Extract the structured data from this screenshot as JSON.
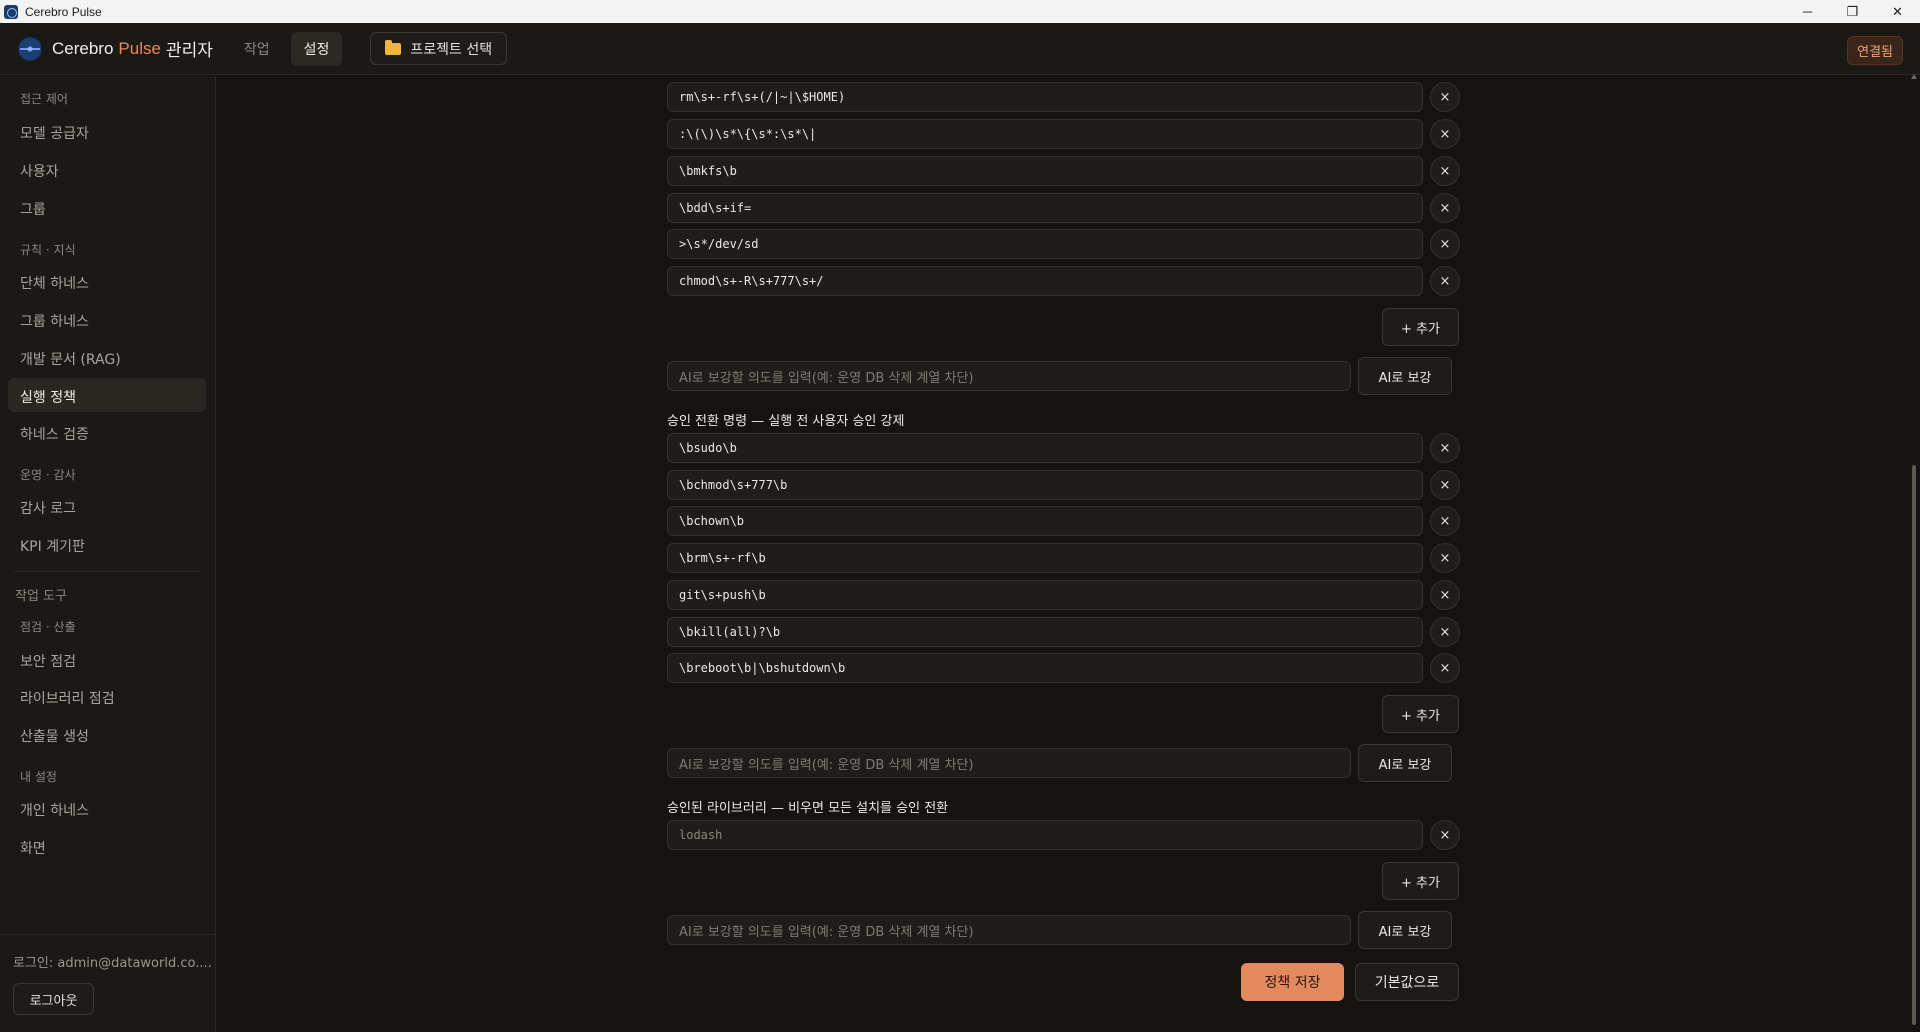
{
  "window": {
    "title": "Cerebro Pulse",
    "minimize": "─",
    "maximize": "❐",
    "close": "✕"
  },
  "header": {
    "brand_name": "Cerebro",
    "brand_pulse": "Pulse",
    "brand_suffix": "관리자",
    "tabs": [
      {
        "label": "작업"
      },
      {
        "label": "설정"
      }
    ],
    "project_button": "프로젝트 선택",
    "connection_status": "연결됨"
  },
  "sidebar": {
    "sections": [
      {
        "title": "접근 제어",
        "items": [
          "모델 공급자",
          "사용자",
          "그룹"
        ]
      },
      {
        "title": "규칙 · 지식",
        "items": [
          "단체 하네스",
          "그룹 하네스",
          "개발 문서 (RAG)",
          "실행 정책",
          "하네스 검증"
        ]
      },
      {
        "title": "운영 · 감사",
        "items": [
          "감사 로그",
          "KPI 계기판"
        ]
      },
      {
        "title": "작업 도구",
        "items": []
      },
      {
        "title": "점검 · 산출",
        "items": [
          "보안 점검",
          "라이브러리 점검",
          "산출물 생성"
        ]
      },
      {
        "title": "내 설정",
        "items": [
          "개인 하네스",
          "화면"
        ]
      }
    ],
    "active_item": "실행 정책",
    "login_text": "로그인: admin@dataworld.co....",
    "logout": "로그아웃"
  },
  "main": {
    "blocked_rules": [
      "rm\\s+-rf\\s+(/|~|\\$HOME)",
      ":\\(\\)\\s*\\{\\s*:\\s*\\|",
      "\\bmkfs\\b",
      "\\bdd\\s+if=",
      ">\\s*/dev/sd",
      "chmod\\s+-R\\s+777\\s+/"
    ],
    "add_label": "+ 추가",
    "ai_placeholder": "AI로 보강할 의도를 입력(예: 운영 DB 삭제 계열 차단)",
    "ai_button": "AI로 보강",
    "remove_label": "×",
    "approval_title": "승인 전환 명령 — 실행 전 사용자 승인 강제",
    "approval_rules": [
      "\\bsudo\\b",
      "\\bchmod\\s+777\\b",
      "\\bchown\\b",
      "\\brm\\s+-rf\\b",
      "git\\s+push\\b",
      "\\bkill(all)?\\b",
      "\\breboot\\b|\\bshutdown\\b"
    ],
    "library_title": "승인된 라이브러리 — 비우면 모든 설치를 승인 전환",
    "library_placeholder": "lodash",
    "save_button": "정책 저장",
    "reset_button": "기본값으로"
  }
}
